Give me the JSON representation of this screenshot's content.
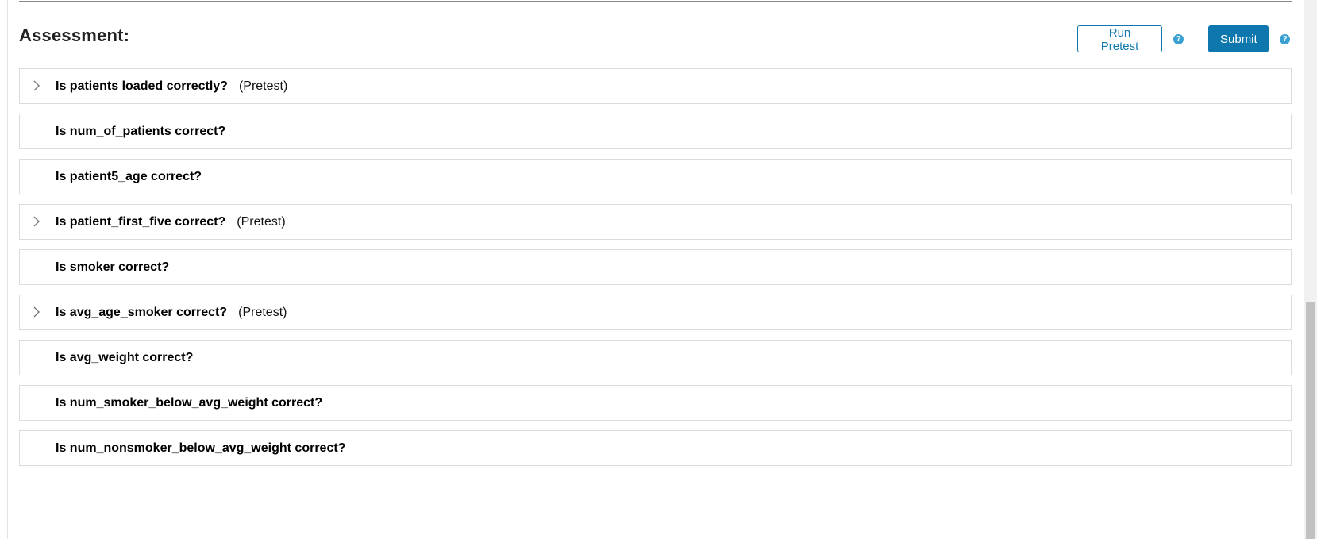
{
  "assessment": {
    "title": "Assessment:",
    "run_pretest_label": "Run Pretest",
    "submit_label": "Submit",
    "help_glyph": "?"
  },
  "tests": [
    {
      "label": "Is patients loaded correctly?",
      "tag": "(Pretest)",
      "expandable": true
    },
    {
      "label": "Is num_of_patients correct?",
      "tag": "",
      "expandable": false
    },
    {
      "label": "Is patient5_age correct?",
      "tag": "",
      "expandable": false
    },
    {
      "label": "Is patient_first_five correct?",
      "tag": "(Pretest)",
      "expandable": true
    },
    {
      "label": "Is smoker correct?",
      "tag": "",
      "expandable": false
    },
    {
      "label": "Is avg_age_smoker correct?",
      "tag": "(Pretest)",
      "expandable": true
    },
    {
      "label": "Is avg_weight correct?",
      "tag": "",
      "expandable": false
    },
    {
      "label": "Is num_smoker_below_avg_weight correct?",
      "tag": "",
      "expandable": false
    },
    {
      "label": "Is num_nonsmoker_below_avg_weight correct?",
      "tag": "",
      "expandable": false
    }
  ],
  "colors": {
    "accent": "#0d77ae",
    "help": "#3a9fd1",
    "border": "#dcdcdc"
  }
}
